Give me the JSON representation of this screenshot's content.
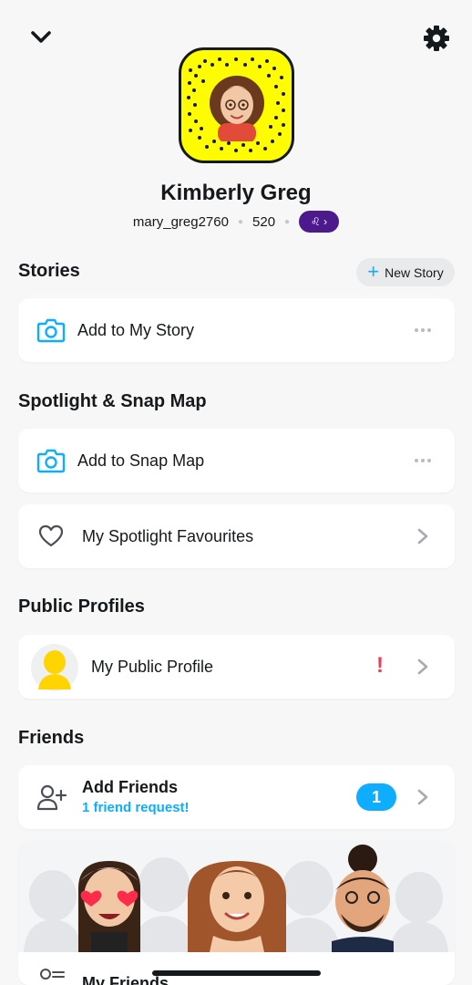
{
  "header": {
    "back_icon": "chevron-down-icon",
    "settings_icon": "gear-icon"
  },
  "profile": {
    "display_name": "Kimberly Greg",
    "username": "mary_greg2760",
    "score": "520",
    "zodiac_badge": "♌ ›",
    "snapcode_color": "#fffc00"
  },
  "stories": {
    "title": "Stories",
    "new_story_label": "New Story",
    "add_to_story_label": "Add to My Story"
  },
  "spotlight": {
    "title": "Spotlight & Snap Map",
    "add_to_map_label": "Add to Snap Map",
    "favourites_label": "My Spotlight Favourites"
  },
  "public_profiles": {
    "title": "Public Profiles",
    "public_profile_label": "My Public Profile",
    "alert_mark": "!"
  },
  "friends": {
    "title": "Friends",
    "add_friends_label": "Add Friends",
    "friend_request_text": "1 friend request!",
    "request_count": "1",
    "my_friends_label": "My Friends"
  },
  "colors": {
    "accent_blue": "#0eadff",
    "snap_yellow": "#fffc00",
    "zodiac_purple": "#4c1a8c",
    "alert_red": "#f23c57"
  }
}
